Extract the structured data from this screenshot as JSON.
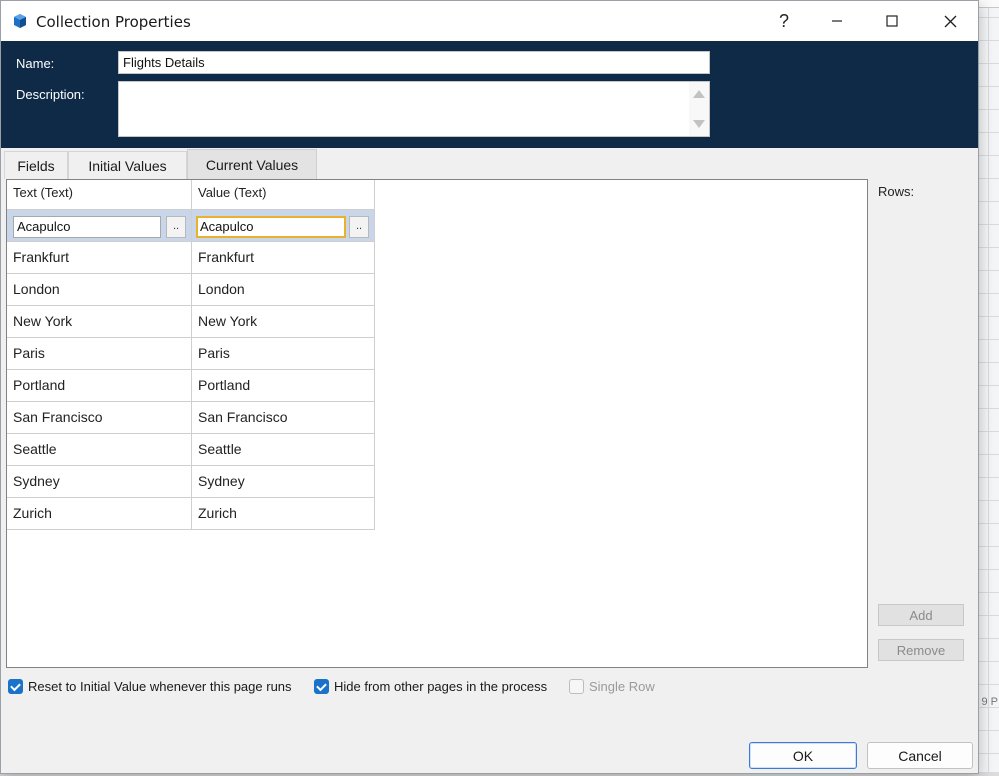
{
  "window": {
    "title": "Collection Properties",
    "help_glyph": "?",
    "icon": "blue-prism-logo-icon"
  },
  "header": {
    "name_label": "Name:",
    "name_value": "Flights Details",
    "description_label": "Description:",
    "description_value": ""
  },
  "tabs": [
    {
      "label": "Fields",
      "active": false
    },
    {
      "label": "Initial Values",
      "active": false
    },
    {
      "label": "Current Values",
      "active": true
    }
  ],
  "grid": {
    "columns": [
      "Text (Text)",
      "Value (Text)"
    ],
    "editing_row": {
      "text": "Acapulco",
      "value": "Acapulco"
    },
    "rows": [
      {
        "text": "Frankfurt",
        "value": "Frankfurt"
      },
      {
        "text": "London",
        "value": "London"
      },
      {
        "text": "New York",
        "value": "New York"
      },
      {
        "text": "Paris",
        "value": "Paris"
      },
      {
        "text": "Portland",
        "value": "Portland"
      },
      {
        "text": "San Francisco",
        "value": "San Francisco"
      },
      {
        "text": "Seattle",
        "value": "Seattle"
      },
      {
        "text": "Sydney",
        "value": "Sydney"
      },
      {
        "text": "Zurich",
        "value": "Zurich"
      }
    ],
    "ellipsis_label": ".."
  },
  "side": {
    "rows_label": "Rows:",
    "add_label": "Add",
    "remove_label": "Remove"
  },
  "options": {
    "reset_label": "Reset to Initial Value whenever this page runs",
    "reset_checked": true,
    "hide_label": "Hide from other pages in the process",
    "hide_checked": true,
    "single_row_label": "Single Row",
    "single_row_checked": false
  },
  "footer": {
    "ok_label": "OK",
    "cancel_label": "Cancel"
  },
  "background": {
    "right_edge_text": "9 P"
  },
  "colors": {
    "header_bg": "#0f2a47",
    "selected_row": "#c9d6ea",
    "focus_border": "#e8b12e",
    "checkbox": "#1a73c8"
  }
}
